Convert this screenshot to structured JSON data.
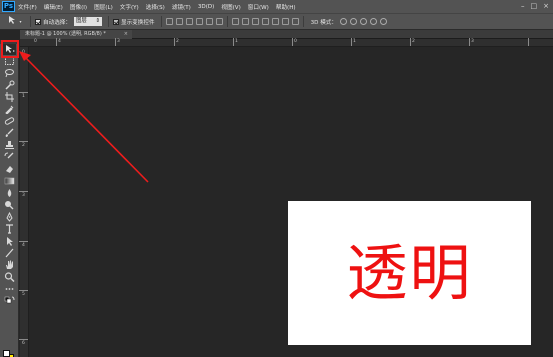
{
  "menubar": {
    "logo": "Ps",
    "items": [
      "文件(F)",
      "编辑(E)",
      "图像(I)",
      "图层(L)",
      "文字(Y)",
      "选择(S)",
      "滤镜(T)",
      "3D(D)",
      "视图(V)",
      "窗口(W)",
      "帮助(H)"
    ],
    "window_controls": [
      "–",
      "□",
      "×"
    ]
  },
  "options": {
    "tool_icon": "move-tool-icon",
    "auto_select_label": "自动选择：",
    "auto_select_value": "图层",
    "show_transform_label": "显示变换控件",
    "mode_3d_label": "3D 模式："
  },
  "document": {
    "tab_title": "未标题-1 @ 100% (透明, RGB/8) *",
    "close_glyph": "×",
    "canvas_text": "透明"
  },
  "rulers": {
    "h": [
      "0",
      "4",
      "3",
      "2",
      "1",
      "0",
      "1",
      "2",
      "3"
    ],
    "v": [
      "0",
      "1",
      "2",
      "3",
      "4",
      "5",
      "6"
    ]
  },
  "colors": {
    "foreground": "#ffffff",
    "background": "#ffe800",
    "annotation": "#ee1c1c",
    "canvas_text": "#ee1111"
  }
}
